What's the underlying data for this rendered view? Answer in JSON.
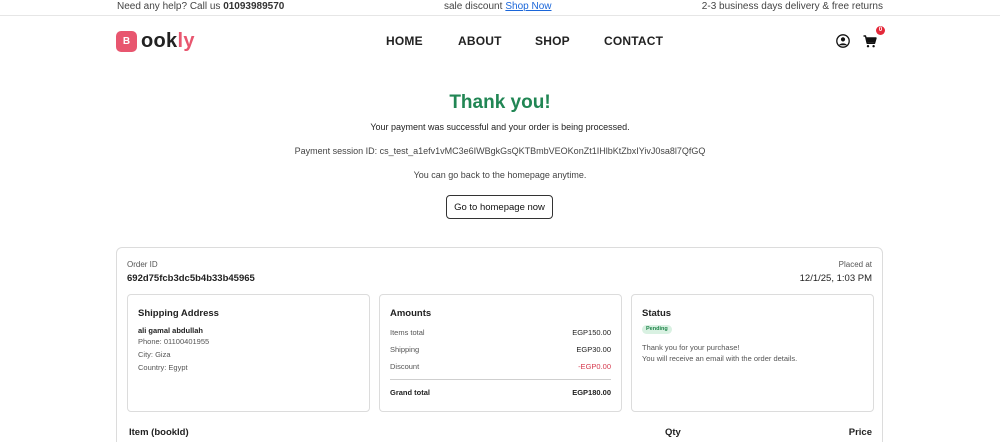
{
  "topbar": {
    "help_text": "Need any help? Call us",
    "phone": "01093989570",
    "sale_text": "sale discount",
    "shop_now_link": "Shop Now",
    "delivery_text": "2-3 business days delivery & free returns"
  },
  "brand": {
    "logo_letter": "B",
    "name_part_dark": "ook",
    "name_part_pink": "ly",
    "accent_color": "#e8566f"
  },
  "nav": {
    "items": [
      "HOME",
      "ABOUT",
      "SHOP",
      "CONTACT"
    ],
    "cart_count": "0",
    "user_icon": "user-icon",
    "cart_icon": "cart-icon"
  },
  "confirmation": {
    "title": "Thank you!",
    "title_color": "#218654",
    "subtitle": "Your payment was successful and your order is being processed.",
    "session_text": "Payment session ID: cs_test_a1efv1vMC3e6IWBgkGsQKTBmbVEOKonZt1IHlbKtZbxIYivJ0sa8l7QfGQ",
    "back_text": "You can go back to the homepage anytime.",
    "home_button": "Go to homepage now"
  },
  "order": {
    "id_label": "Order ID",
    "id": "692d75fcb3dc5b4b33b45965",
    "placed_label": "Placed at",
    "placed_at": "12/1/25, 1:03 PM"
  },
  "shipping": {
    "title": "Shipping Address",
    "name": "ali gamal abdullah",
    "phone": "Phone: 01100401955",
    "city": "City: Giza",
    "country": "Country: Egypt"
  },
  "amounts": {
    "title": "Amounts",
    "items_total_label": "Items total",
    "items_total": "EGP150.00",
    "shipping_label": "Shipping",
    "shipping": "EGP30.00",
    "discount_label": "Discount",
    "discount": "-EGP0.00",
    "grand_total_label": "Grand total",
    "grand_total": "EGP180.00"
  },
  "status": {
    "title": "Status",
    "badge": "Pending",
    "line1": "Thank you for your purchase!",
    "line2": "You will receive an email with the order details."
  },
  "items_table": {
    "columns": [
      "Item (bookId)",
      "Qty",
      "Price"
    ]
  }
}
